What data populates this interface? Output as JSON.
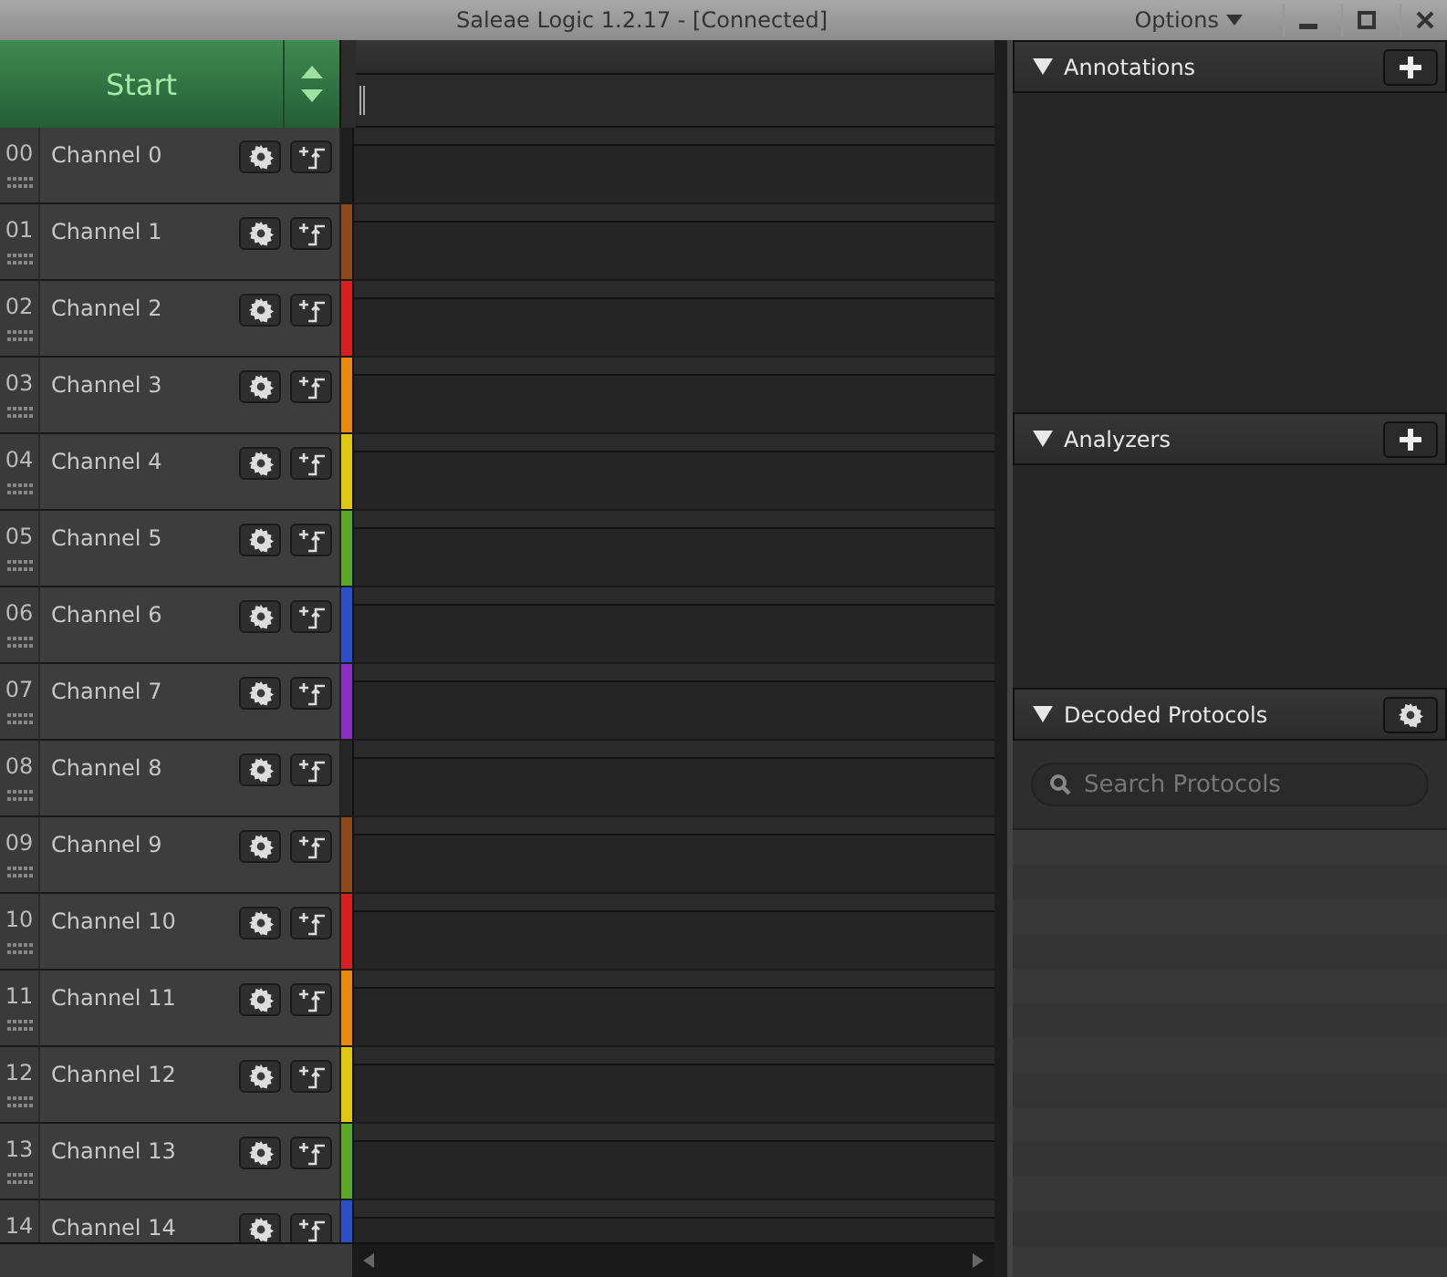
{
  "window": {
    "title": "Saleae Logic 1.2.17 - [Connected]",
    "menu": "Options"
  },
  "start_button": {
    "label": "Start"
  },
  "channels": [
    {
      "number": "00",
      "name": "Channel 0",
      "color": "#1e1e1e"
    },
    {
      "number": "01",
      "name": "Channel 1",
      "color": "#8a4a1c"
    },
    {
      "number": "02",
      "name": "Channel 2",
      "color": "#d42020"
    },
    {
      "number": "03",
      "name": "Channel 3",
      "color": "#e88a10"
    },
    {
      "number": "04",
      "name": "Channel 4",
      "color": "#e0c810"
    },
    {
      "number": "05",
      "name": "Channel 5",
      "color": "#5aa828"
    },
    {
      "number": "06",
      "name": "Channel 6",
      "color": "#2a50c8"
    },
    {
      "number": "07",
      "name": "Channel 7",
      "color": "#8a30c0"
    },
    {
      "number": "08",
      "name": "Channel 8",
      "color": "#262626"
    },
    {
      "number": "09",
      "name": "Channel 9",
      "color": "#8a4a1c"
    },
    {
      "number": "10",
      "name": "Channel 10",
      "color": "#d42020"
    },
    {
      "number": "11",
      "name": "Channel 11",
      "color": "#e88a10"
    },
    {
      "number": "12",
      "name": "Channel 12",
      "color": "#e0c810"
    },
    {
      "number": "13",
      "name": "Channel 13",
      "color": "#5aa828"
    },
    {
      "number": "14",
      "name": "Channel 14",
      "color": "#2a50c8"
    }
  ],
  "panels": [
    {
      "title": "Annotations",
      "kind": "add"
    },
    {
      "title": "Analyzers",
      "kind": "add"
    },
    {
      "title": "Decoded Protocols",
      "kind": "settings",
      "search": {
        "placeholder": "Search Protocols"
      }
    }
  ]
}
